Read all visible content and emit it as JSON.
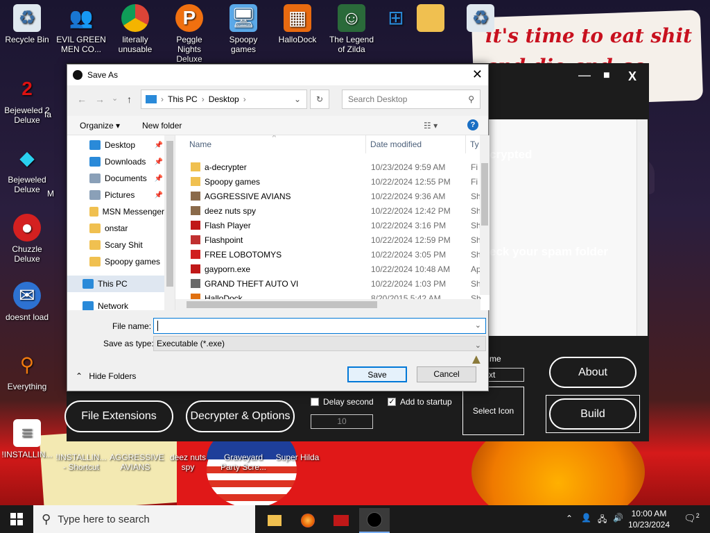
{
  "desktop": {
    "sign_text": "it's time to eat shit and die and go trick !",
    "icons_left": [
      {
        "label": "Recycle Bin",
        "icon": "recycle-bin-icon"
      },
      {
        "label": "Bejeweled 2 Deluxe",
        "icon": "bejeweled2-icon"
      },
      {
        "label": "Bejeweled Deluxe",
        "icon": "bejeweled-icon"
      },
      {
        "label": "Chuzzle Deluxe",
        "icon": "chuzzle-icon"
      },
      {
        "label": "doesnt load",
        "icon": "thunderbird-icon"
      },
      {
        "label": "Everything",
        "icon": "everything-icon"
      },
      {
        "label": "!INSTALLIN...",
        "icon": "document-icon"
      }
    ],
    "icons_top": [
      {
        "label": "EVIL GREEN MEN CO...",
        "icon": "msn-icon"
      },
      {
        "label": "literally unusable",
        "icon": "chrome-icon"
      },
      {
        "label": "Peggle Nights Deluxe",
        "icon": "peggle-icon"
      },
      {
        "label": "Spoopy games",
        "icon": "folder-computer-icon"
      },
      {
        "label": "HalloDock",
        "icon": "hallodock-icon"
      },
      {
        "label": "The Legend of Zilda",
        "icon": "zilda-icon"
      }
    ],
    "icons_top_extra": [
      {
        "label": "",
        "icon": "windows-drive-icon"
      },
      {
        "label": "",
        "icon": "folder-icon"
      },
      {
        "label": "",
        "icon": "recycle-bin-icon"
      }
    ],
    "icons_bottom": [
      {
        "label": "!INSTALLIN... - Shortcut"
      },
      {
        "label": "AGGRESSIVE AVIANS"
      },
      {
        "label": "deez nuts spy"
      },
      {
        "label": "Graveyard Party Scre..."
      },
      {
        "label": "Super Hilda"
      }
    ],
    "partial_labels": [
      "fa",
      "M"
    ]
  },
  "app": {
    "text_crypted": "crypted",
    "text_spam": "eck your spam folder",
    "text_me": "me",
    "text_xt": "xt",
    "btn_file_extensions": "File Extensions",
    "btn_decrypter": "Decrypter & Options",
    "chk_delay": "Delay second",
    "chk_startup": "Add to startup",
    "delay_value": "10",
    "btn_select_icon": "Select Icon",
    "btn_about": "About",
    "btn_build": "Build",
    "ctrl_min": "—",
    "ctrl_max": "■",
    "ctrl_close": "X"
  },
  "dialog": {
    "title": "Save As",
    "close": "✕",
    "breadcrumb": [
      "This PC",
      "Desktop"
    ],
    "search_placeholder": "Search Desktop",
    "organize": "Organize ▾",
    "new_folder": "New folder",
    "help": "?",
    "nav_items": [
      {
        "label": "Desktop",
        "pinned": true,
        "color": "#2a8ad9"
      },
      {
        "label": "Downloads",
        "pinned": true,
        "color": "#2a8ad9"
      },
      {
        "label": "Documents",
        "pinned": true,
        "color": "#8aa0b8"
      },
      {
        "label": "Pictures",
        "pinned": true,
        "color": "#8aa0b8"
      },
      {
        "label": "MSN Messenger",
        "pinned": false,
        "color": "#f0c050"
      },
      {
        "label": "onstar",
        "pinned": false,
        "color": "#f0c050"
      },
      {
        "label": "Scary Shit",
        "pinned": false,
        "color": "#f0c050"
      },
      {
        "label": "Spoopy games",
        "pinned": false,
        "color": "#f0c050"
      },
      {
        "label": "This PC",
        "pinned": false,
        "color": "#2a8ad9"
      },
      {
        "label": "Network",
        "pinned": false,
        "color": "#2a8ad9"
      }
    ],
    "columns": {
      "name": "Name",
      "date": "Date modified",
      "type": "Ty"
    },
    "files": [
      {
        "name": "a-decrypter",
        "date": "10/23/2024 9:59 AM",
        "type": "Fi",
        "color": "#f0c050"
      },
      {
        "name": "Spoopy games",
        "date": "10/22/2024 12:55 PM",
        "type": "Fi",
        "color": "#f0c050"
      },
      {
        "name": "AGGRESSIVE AVIANS",
        "date": "10/22/2024 9:36 AM",
        "type": "Sh",
        "color": "#8a6a4a"
      },
      {
        "name": "deez nuts spy",
        "date": "10/22/2024 12:42 PM",
        "type": "Sh",
        "color": "#8a6a4a"
      },
      {
        "name": "Flash Player",
        "date": "10/22/2024 3:16 PM",
        "type": "Sh",
        "color": "#c01818"
      },
      {
        "name": "Flashpoint",
        "date": "10/22/2024 12:59 PM",
        "type": "Sh",
        "color": "#c03030"
      },
      {
        "name": "FREE LOBOTOMYS",
        "date": "10/22/2024 3:05 PM",
        "type": "Sh",
        "color": "#d02020"
      },
      {
        "name": "gayporn.exe",
        "date": "10/22/2024 10:48 AM",
        "type": "Ap",
        "color": "#c01818"
      },
      {
        "name": "GRAND THEFT AUTO VI",
        "date": "10/22/2024 1:03 PM",
        "type": "Sh",
        "color": "#6a6a6a"
      },
      {
        "name": "HalloDock",
        "date": "8/20/2015 5:42 AM",
        "type": "Sh",
        "color": "#e07010"
      }
    ],
    "file_name_label": "File name:",
    "file_name_value": "",
    "save_type_label": "Save as type:",
    "save_type_value": "Executable (*.exe)",
    "hide_folders": "Hide Folders",
    "save_btn": "Save",
    "cancel_btn": "Cancel"
  },
  "taskbar": {
    "search_placeholder": "Type here to search",
    "time": "10:00 AM",
    "date": "10/23/2024",
    "notifications": "2"
  }
}
